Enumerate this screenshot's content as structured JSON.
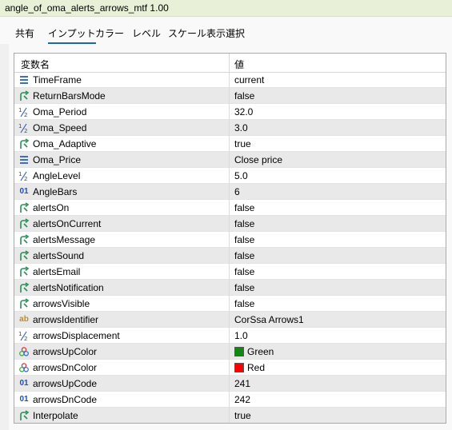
{
  "window": {
    "title": "angle_of_oma_alerts_arrows_mtf 1.00"
  },
  "tabs": [
    {
      "label": "共有"
    },
    {
      "label": "インプット"
    },
    {
      "label": "カラー"
    },
    {
      "label": "レベル"
    },
    {
      "label": "スケール"
    },
    {
      "label": "表示選択"
    }
  ],
  "active_tab": "インプット",
  "table": {
    "headers": {
      "name": "変数名",
      "value": "値"
    },
    "rows": [
      {
        "icon": "enum-icon",
        "name": "TimeFrame",
        "value": "current"
      },
      {
        "icon": "bool-icon",
        "name": "ReturnBarsMode",
        "value": "false"
      },
      {
        "icon": "double-icon",
        "name": "Oma_Period",
        "value": "32.0"
      },
      {
        "icon": "double-icon",
        "name": "Oma_Speed",
        "value": "3.0"
      },
      {
        "icon": "bool-icon",
        "name": "Oma_Adaptive",
        "value": "true"
      },
      {
        "icon": "enum-icon",
        "name": "Oma_Price",
        "value": "Close price"
      },
      {
        "icon": "double-icon",
        "name": "AngleLevel",
        "value": "5.0"
      },
      {
        "icon": "int-icon",
        "name": "AngleBars",
        "value": "6"
      },
      {
        "icon": "bool-icon",
        "name": "alertsOn",
        "value": "false"
      },
      {
        "icon": "bool-icon",
        "name": "alertsOnCurrent",
        "value": "false"
      },
      {
        "icon": "bool-icon",
        "name": "alertsMessage",
        "value": "false"
      },
      {
        "icon": "bool-icon",
        "name": "alertsSound",
        "value": "false"
      },
      {
        "icon": "bool-icon",
        "name": "alertsEmail",
        "value": "false"
      },
      {
        "icon": "bool-icon",
        "name": "alertsNotification",
        "value": "false"
      },
      {
        "icon": "bool-icon",
        "name": "arrowsVisible",
        "value": "false"
      },
      {
        "icon": "string-icon",
        "name": "arrowsIdentifier",
        "value": "CorSsa Arrows1"
      },
      {
        "icon": "double-icon",
        "name": "arrowsDisplacement",
        "value": "1.0"
      },
      {
        "icon": "color-icon",
        "name": "arrowsUpColor",
        "value": "Green",
        "swatch": "#0f8a0f"
      },
      {
        "icon": "color-icon",
        "name": "arrowsDnColor",
        "value": "Red",
        "swatch": "#ff0000"
      },
      {
        "icon": "int-icon",
        "name": "arrowsUpCode",
        "value": "241"
      },
      {
        "icon": "int-icon",
        "name": "arrowsDnCode",
        "value": "242"
      },
      {
        "icon": "bool-icon",
        "name": "Interpolate",
        "value": "true"
      }
    ]
  },
  "colors": {
    "accent": "#1a66b3",
    "title_bg": "#e8f0d8",
    "bool_icon": "#2e8b57",
    "int_icon": "#1f4fb8",
    "string_icon": "#c08a2a"
  }
}
